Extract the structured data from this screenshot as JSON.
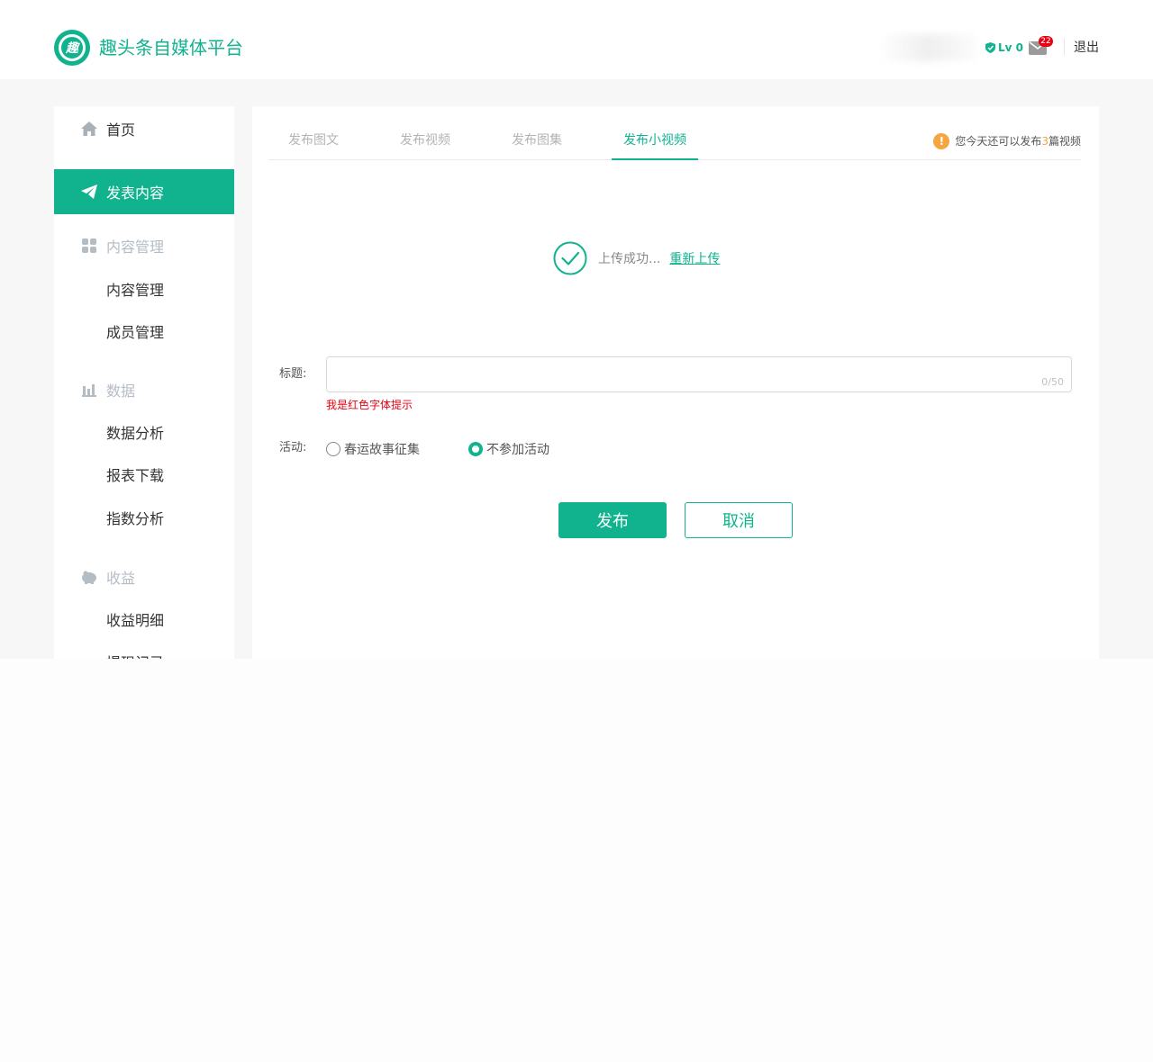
{
  "brand": {
    "name": "趣头条自媒体平台",
    "logo_char": "趣"
  },
  "header": {
    "level": "Lv 0",
    "mail_badge": "22",
    "logout": "退出"
  },
  "sidebar": {
    "home": "首页",
    "publish": "发表内容",
    "content_group": "内容管理",
    "content_items": [
      "内容管理",
      "成员管理"
    ],
    "data_group": "数据",
    "data_items": [
      "数据分析",
      "报表下载",
      "指数分析"
    ],
    "income_group": "收益",
    "income_items": [
      "收益明细",
      "提现记录"
    ]
  },
  "tabs": [
    "发布图文",
    "发布视频",
    "发布图集",
    "发布小视频"
  ],
  "active_tab": "发布小视频",
  "notice": {
    "prefix": "您今天还可以发布",
    "count": "3",
    "suffix": "篇视频"
  },
  "upload": {
    "status": "上传成功...",
    "reupload": "重新上传"
  },
  "form": {
    "title_label": "标题:",
    "title_value": "",
    "title_counter": "0/50",
    "title_error": "我是红色字体提示",
    "activity_label": "活动:",
    "activity_options": [
      "春运故事征集",
      "不参加活动"
    ],
    "activity_selected": "不参加活动"
  },
  "buttons": {
    "publish": "发布",
    "cancel": "取消"
  },
  "colors": {
    "accent": "#11b38f",
    "warning": "#f5a640",
    "error": "#e60012"
  }
}
